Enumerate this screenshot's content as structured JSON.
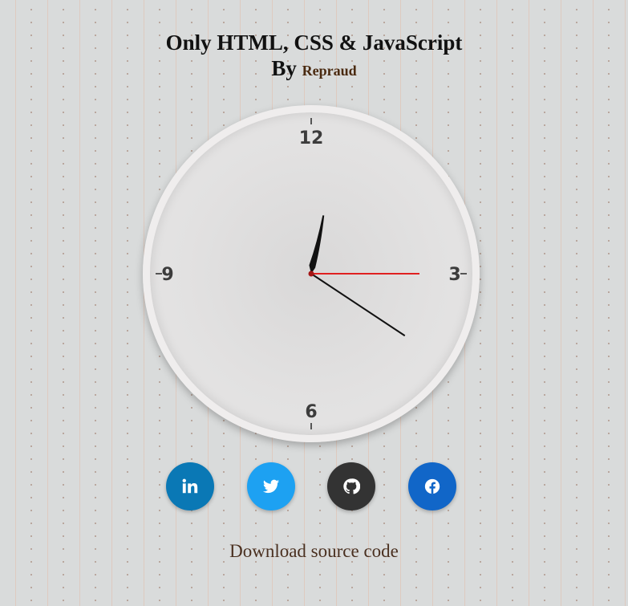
{
  "header": {
    "title": "Only HTML, CSS & JavaScript",
    "by_label": "By",
    "author": "Repraud"
  },
  "clock": {
    "numerals": {
      "twelve": "12",
      "three": "3",
      "six": "6",
      "nine": "9"
    },
    "time": {
      "hour": 12,
      "minute": 20,
      "second": 15
    },
    "colors": {
      "hour_hand": "#111111",
      "minute_hand": "#111111",
      "second_hand": "#e02020"
    }
  },
  "socials": [
    {
      "name": "linkedin",
      "icon": "linkedin-icon",
      "color": "#0a78b5"
    },
    {
      "name": "twitter",
      "icon": "twitter-icon",
      "color": "#1da1f2"
    },
    {
      "name": "github",
      "icon": "github-icon",
      "color": "#333333"
    },
    {
      "name": "facebook",
      "icon": "facebook-icon",
      "color": "#1166c8"
    }
  ],
  "footer": {
    "download_label": "Download source code"
  }
}
